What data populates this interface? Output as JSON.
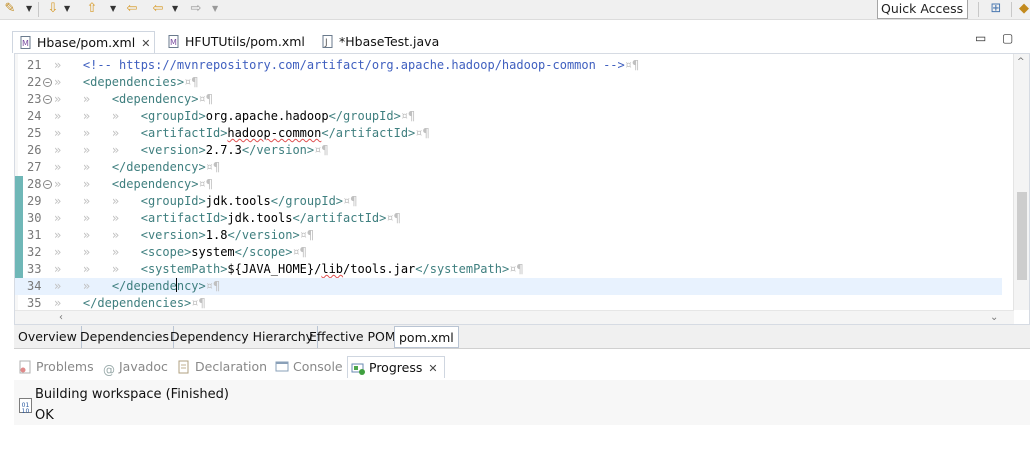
{
  "toolbar": {
    "quick_access": "Quick Access"
  },
  "editor_tabs": [
    {
      "label": "Hbase/pom.xml",
      "close": "✕"
    },
    {
      "label": "HFUTUtils/pom.xml"
    },
    {
      "label": "*HbaseTest.java"
    }
  ],
  "editor": {
    "lines": [
      {
        "num": "21",
        "marker": "",
        "indent": 1,
        "parts": [
          {
            "t": "<!-- https://mvnrepository.com/artifact/org.apache.hadoop/hadoop-common -->",
            "c": "cmt"
          }
        ]
      },
      {
        "num": "22",
        "marker": "⊖",
        "indent": 1,
        "parts": [
          {
            "t": "<dependencies>",
            "c": "tag"
          }
        ]
      },
      {
        "num": "23",
        "marker": "⊖",
        "indent": 2,
        "parts": [
          {
            "t": "<dependency>",
            "c": "tag"
          }
        ]
      },
      {
        "num": "24",
        "marker": "",
        "indent": 3,
        "parts": [
          {
            "t": "<groupId>",
            "c": "tag"
          },
          {
            "t": "org.apache.hadoop",
            "c": "txt"
          },
          {
            "t": "</groupId>",
            "c": "tag"
          }
        ]
      },
      {
        "num": "25",
        "marker": "",
        "indent": 3,
        "parts": [
          {
            "t": "<artifactId>",
            "c": "tag"
          },
          {
            "t": "hadoop-common",
            "c": "txt err"
          },
          {
            "t": "</artifactId>",
            "c": "tag"
          }
        ]
      },
      {
        "num": "26",
        "marker": "",
        "indent": 3,
        "parts": [
          {
            "t": "<version>",
            "c": "tag"
          },
          {
            "t": "2.7.3",
            "c": "txt"
          },
          {
            "t": "</version>",
            "c": "tag"
          }
        ]
      },
      {
        "num": "27",
        "marker": "",
        "indent": 2,
        "parts": [
          {
            "t": "</dependency>",
            "c": "tag"
          }
        ]
      },
      {
        "num": "28",
        "marker": "⊖",
        "indent": 2,
        "parts": [
          {
            "t": "<dependency>",
            "c": "tag"
          }
        ]
      },
      {
        "num": "29",
        "marker": "",
        "indent": 3,
        "parts": [
          {
            "t": "<groupId>",
            "c": "tag"
          },
          {
            "t": "jdk.tools",
            "c": "txt"
          },
          {
            "t": "</groupId>",
            "c": "tag"
          }
        ]
      },
      {
        "num": "30",
        "marker": "",
        "indent": 3,
        "parts": [
          {
            "t": "<artifactId>",
            "c": "tag"
          },
          {
            "t": "jdk.tools",
            "c": "txt"
          },
          {
            "t": "</artifactId>",
            "c": "tag"
          }
        ]
      },
      {
        "num": "31",
        "marker": "",
        "indent": 3,
        "parts": [
          {
            "t": "<version>",
            "c": "tag"
          },
          {
            "t": "1.8",
            "c": "txt"
          },
          {
            "t": "</version>",
            "c": "tag"
          }
        ]
      },
      {
        "num": "32",
        "marker": "",
        "indent": 3,
        "parts": [
          {
            "t": "<scope>",
            "c": "tag"
          },
          {
            "t": "system",
            "c": "txt"
          },
          {
            "t": "</scope>",
            "c": "tag"
          }
        ]
      },
      {
        "num": "33",
        "marker": "",
        "indent": 3,
        "parts": [
          {
            "t": "<systemPath>",
            "c": "tag"
          },
          {
            "t": "${JAVA_HOME}/",
            "c": "txt"
          },
          {
            "t": "lib",
            "c": "txt err"
          },
          {
            "t": "/tools.jar",
            "c": "txt"
          },
          {
            "t": "</systemPath>",
            "c": "tag"
          }
        ]
      },
      {
        "num": "34",
        "marker": "",
        "indent": 2,
        "current": true,
        "parts": [
          {
            "t": "</depende",
            "c": "tag"
          },
          {
            "t": "|",
            "c": "caret"
          },
          {
            "t": "ncy>",
            "c": "tag"
          }
        ]
      },
      {
        "num": "35",
        "marker": "",
        "indent": 1,
        "parts": [
          {
            "t": "</dependencies>",
            "c": "tag"
          }
        ]
      }
    ],
    "whitespace_tab": "»",
    "line_end": "¤¶"
  },
  "pom_tabs": [
    "Overview",
    "Dependencies",
    "Dependency Hierarchy",
    "Effective POM",
    "pom.xml"
  ],
  "views": {
    "tabs": [
      {
        "label": "Problems",
        "icon": "problems-icon"
      },
      {
        "label": "Javadoc",
        "icon": "javadoc-icon"
      },
      {
        "label": "Declaration",
        "icon": "declaration-icon"
      },
      {
        "label": "Console",
        "icon": "console-icon"
      },
      {
        "label": "Progress",
        "icon": "progress-icon",
        "close": "✕"
      }
    ],
    "task": {
      "name": "Building workspace (Finished)",
      "status": "OK"
    }
  }
}
